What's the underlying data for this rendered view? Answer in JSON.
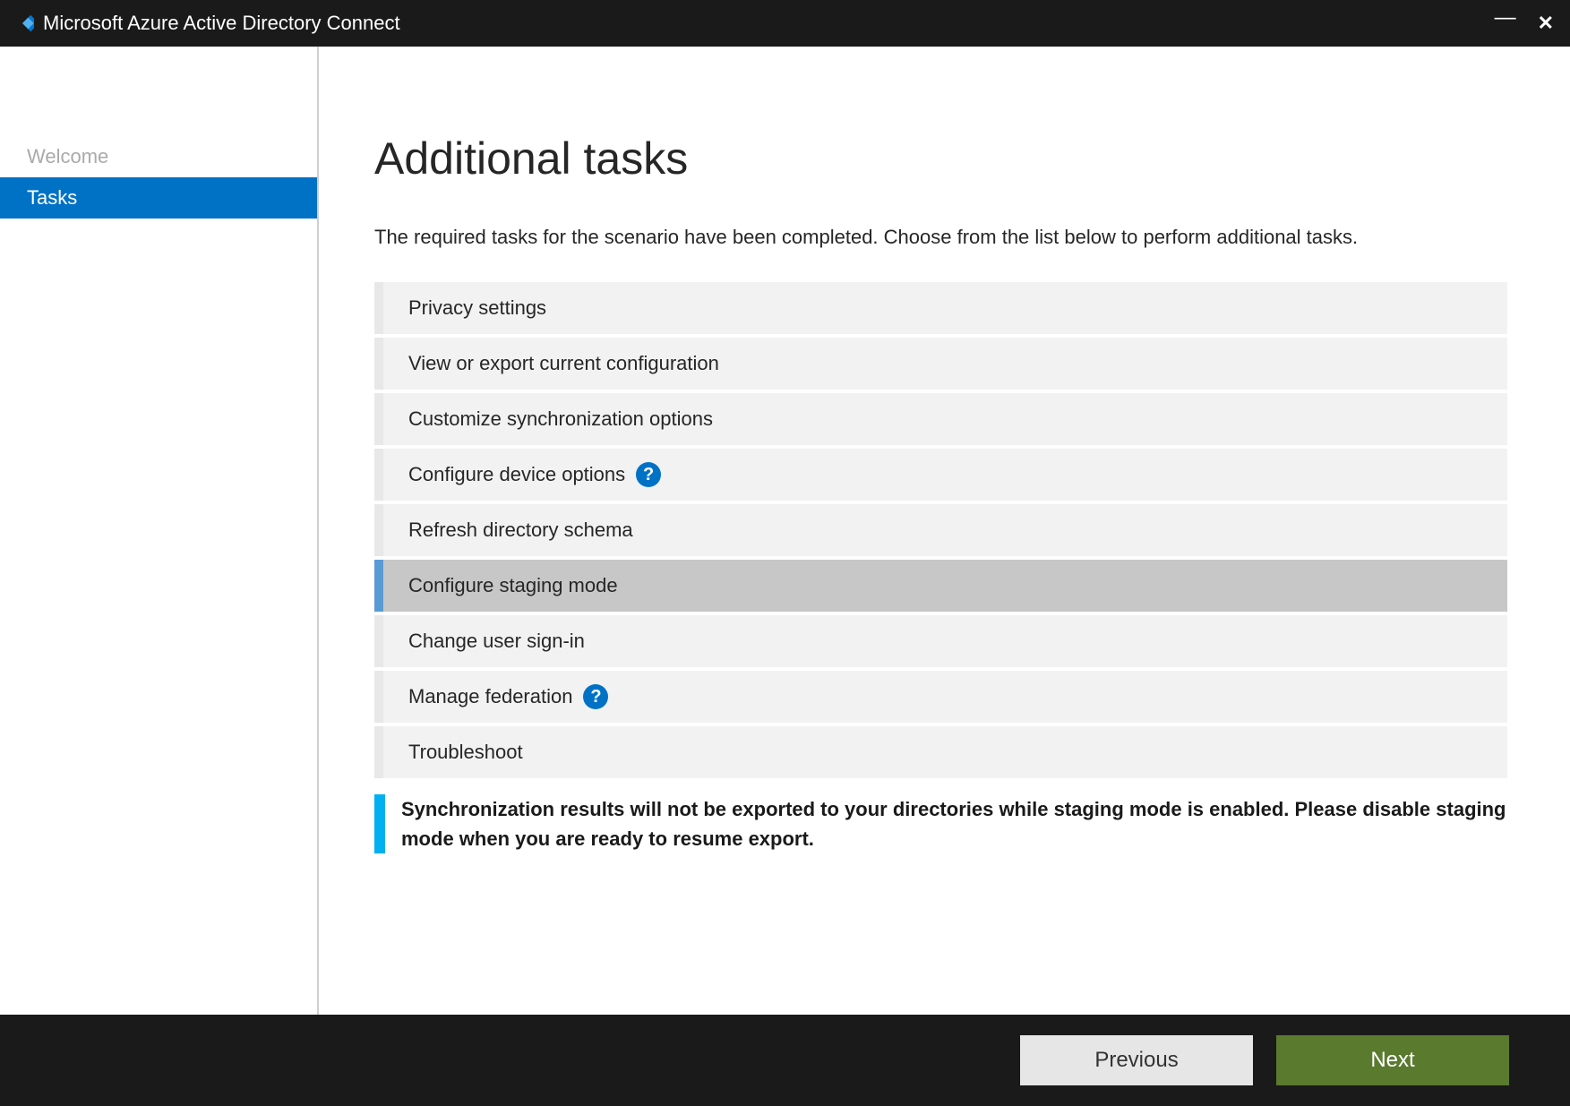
{
  "titlebar": {
    "title": "Microsoft Azure Active Directory Connect"
  },
  "sidebar": {
    "items": [
      {
        "label": "Welcome",
        "active": false
      },
      {
        "label": "Tasks",
        "active": true
      }
    ]
  },
  "main": {
    "heading": "Additional tasks",
    "description": "The required tasks for the scenario have been completed. Choose from the list below to perform additional tasks.",
    "tasks": [
      {
        "label": "Privacy settings",
        "selected": false,
        "help": false
      },
      {
        "label": "View or export current configuration",
        "selected": false,
        "help": false
      },
      {
        "label": "Customize synchronization options",
        "selected": false,
        "help": false
      },
      {
        "label": "Configure device options",
        "selected": false,
        "help": true
      },
      {
        "label": "Refresh directory schema",
        "selected": false,
        "help": false
      },
      {
        "label": "Configure staging mode",
        "selected": true,
        "help": false
      },
      {
        "label": "Change user sign-in",
        "selected": false,
        "help": false
      },
      {
        "label": "Manage federation",
        "selected": false,
        "help": true
      },
      {
        "label": "Troubleshoot",
        "selected": false,
        "help": false
      }
    ],
    "info_banner": "Synchronization results will not be exported to your directories while staging mode is enabled. Please disable staging mode when you are ready to resume export."
  },
  "footer": {
    "previous_label": "Previous",
    "next_label": "Next"
  },
  "help_glyph": "?"
}
